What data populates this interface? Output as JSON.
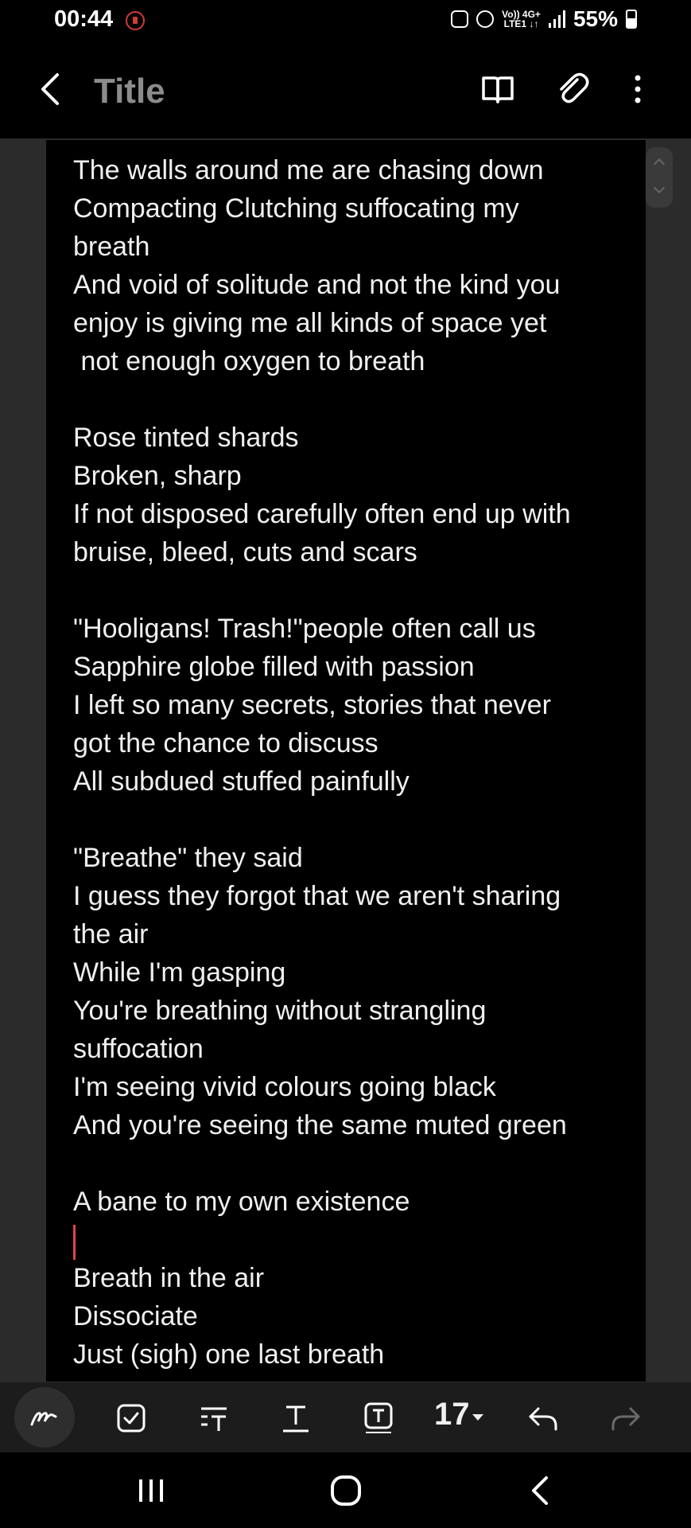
{
  "status_bar": {
    "time": "00:44",
    "network_top": "Vo)) 4G+",
    "network_bottom": "LTE1 ↓↑",
    "battery": "55%"
  },
  "header": {
    "title": "Title",
    "icons": [
      "back-chevron-icon",
      "book-icon",
      "paperclip-icon",
      "more-vertical-icon"
    ]
  },
  "note": {
    "lines": [
      "The walls around me are chasing down",
      "Compacting Clutching suffocating my",
      "breath",
      "And void of solitude and not the kind you",
      "enjoy is giving me all kinds of space yet",
      " not enough oxygen to breath",
      "",
      "Rose tinted shards",
      "Broken, sharp",
      "If not disposed carefully often end up with",
      "bruise, bleed, cuts and scars",
      "",
      "\"Hooligans! Trash!\"people often call us",
      "Sapphire globe filled with passion",
      "I left so many secrets, stories that never",
      "got the chance to discuss",
      "All subdued stuffed painfully",
      "",
      "\"Breathe\" they said",
      "I guess they forgot that we aren't sharing",
      "the air",
      "While I'm gasping",
      "You're breathing without strangling",
      "suffocation",
      "I'm seeing vivid colours going black",
      "And you're seeing the same muted green",
      "",
      "A bane to my own existence",
      "",
      "Breath in the air",
      "Dissociate",
      "Just (sigh) one last breath"
    ],
    "cursor_line_index": 28,
    "cursor_color": "#e04646"
  },
  "toolbar": {
    "font_size": "17",
    "icons": [
      "pen-icon",
      "checkbox-icon",
      "paragraph-style-icon",
      "text-style-icon",
      "text-box-icon",
      "font-size-dropdown",
      "undo-icon",
      "redo-icon"
    ]
  },
  "navbar": {
    "icons": [
      "recent-apps-icon",
      "home-icon",
      "back-icon"
    ]
  },
  "colors": {
    "background": "#000000",
    "page_margin": "#2b2b2b",
    "toolbar": "#1c1c1c",
    "title": "#8c8c8c"
  }
}
